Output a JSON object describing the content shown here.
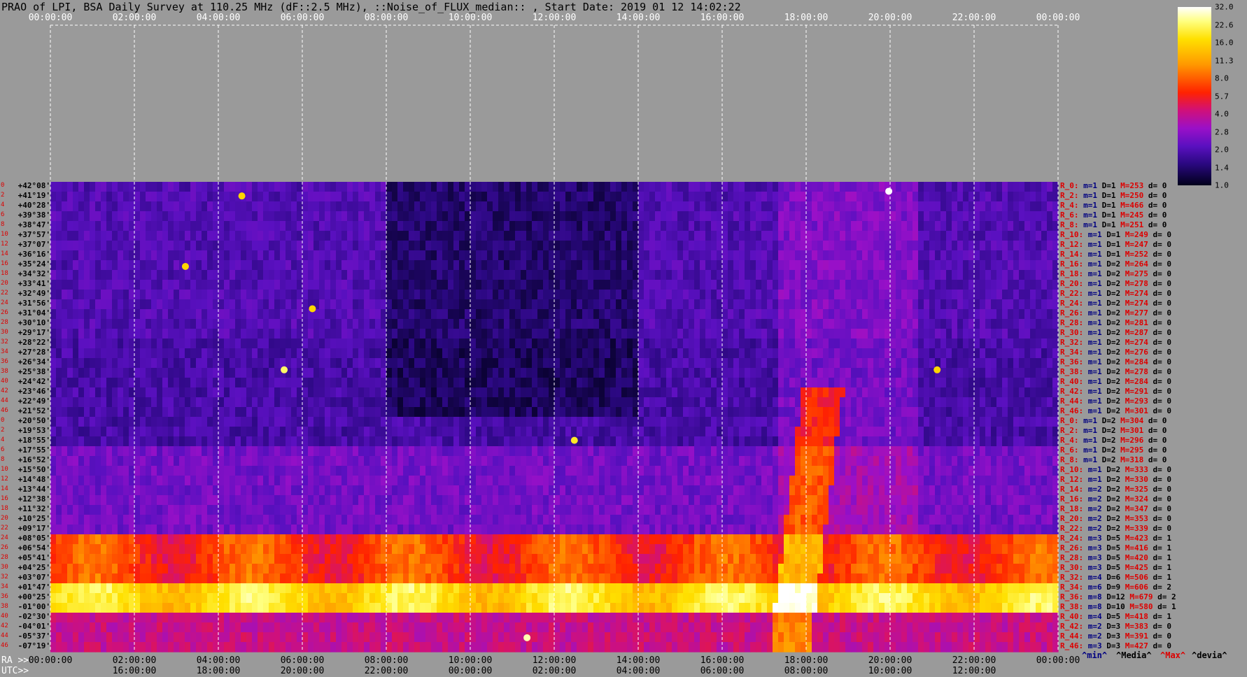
{
  "title": "PRAO of LPI, BSA Daily Survey at 110.25 MHz (dF::2.5 MHz), ::Noise_of_FLUX_median:: , Start Date: 2019 01 12 14:02:22",
  "axis": {
    "ra_prefix": "RA >>",
    "utc_prefix": "UTC>>"
  },
  "chart_data": {
    "type": "heatmap",
    "title": "PRAO of LPI, BSA Daily Survey at 110.25 MHz (dF::2.5 MHz), ::Noise_of_FLUX_median:: , Start Date: 2019 01 12 14:02:22",
    "x_ticks_top": [
      "00:00:00",
      "02:00:00",
      "04:00:00",
      "06:00:00",
      "08:00:00",
      "10:00:00",
      "12:00:00",
      "14:00:00",
      "16:00:00",
      "18:00:00",
      "20:00:00",
      "22:00:00",
      "00:00:00"
    ],
    "x_ticks_ra": [
      "00:00:00",
      "02:00:00",
      "04:00:00",
      "06:00:00",
      "08:00:00",
      "10:00:00",
      "12:00:00",
      "14:00:00",
      "16:00:00",
      "18:00:00",
      "20:00:00",
      "22:00:00",
      "00:00:00"
    ],
    "x_ticks_utc": [
      "16:00:00",
      "18:00:00",
      "20:00:00",
      "22:00:00",
      "00:00:00",
      "02:00:00",
      "04:00:00",
      "06:00:00",
      "08:00:00",
      "10:00:00",
      "12:00:00"
    ],
    "y_ticks_dec": [
      "+42°08'",
      "+41°19'",
      "+40°28'",
      "+39°38'",
      "+38°47'",
      "+37°57'",
      "+37°07'",
      "+36°16'",
      "+35°24'",
      "+34°32'",
      "+33°41'",
      "+32°49'",
      "+31°56'",
      "+31°04'",
      "+30°10'",
      "+29°17'",
      "+28°22'",
      "+27°28'",
      "+26°34'",
      "+25°38'",
      "+24°42'",
      "+23°46'",
      "+22°49'",
      "+21°52'",
      "+20°50'",
      "+19°53'",
      "+18°55'",
      "+17°55'",
      "+16°52'",
      "+15°50'",
      "+14°48'",
      "+13°44'",
      "+12°38'",
      "+11°32'",
      "+10°25'",
      "+09°17'",
      "+08°05'",
      "+06°54'",
      "+05°41'",
      "+04°25'",
      "+03°07'",
      "+01°47'",
      "+00°25'",
      "-01°00'",
      "-02°30'",
      "-04°01'",
      "-05°37'",
      "-07°19'"
    ],
    "colorbar_ticks": [
      "32.0",
      "22.6",
      "16.0",
      "11.3",
      "8.0",
      "5.7",
      "4.0",
      "2.8",
      "2.0",
      "1.4",
      "1.0"
    ],
    "colorbar_scale": "log",
    "legend": [
      "^min^",
      "^Media^",
      "^Max^",
      "^devia^"
    ],
    "row_stats": [
      {
        "r": "R_0:",
        "m": "m=1",
        "D": "D=1",
        "M": "M=253",
        "d": "d= 0"
      },
      {
        "r": "R_2:",
        "m": "m=1",
        "D": "D=1",
        "M": "M=250",
        "d": "d= 0"
      },
      {
        "r": "R_4:",
        "m": "m=1",
        "D": "D=1",
        "M": "M=466",
        "d": "d= 0"
      },
      {
        "r": "R_6:",
        "m": "m=1",
        "D": "D=1",
        "M": "M=245",
        "d": "d= 0"
      },
      {
        "r": "R_8:",
        "m": "m=1",
        "D": "D=1",
        "M": "M=251",
        "d": "d= 0"
      },
      {
        "r": "R_10:",
        "m": "m=1",
        "D": "D=1",
        "M": "M=249",
        "d": "d= 0"
      },
      {
        "r": "R_12:",
        "m": "m=1",
        "D": "D=1",
        "M": "M=247",
        "d": "d= 0"
      },
      {
        "r": "R_14:",
        "m": "m=1",
        "D": "D=1",
        "M": "M=252",
        "d": "d= 0"
      },
      {
        "r": "R_16:",
        "m": "m=1",
        "D": "D=2",
        "M": "M=264",
        "d": "d= 0"
      },
      {
        "r": "R_18:",
        "m": "m=1",
        "D": "D=2",
        "M": "M=275",
        "d": "d= 0"
      },
      {
        "r": "R_20:",
        "m": "m=1",
        "D": "D=2",
        "M": "M=278",
        "d": "d= 0"
      },
      {
        "r": "R_22:",
        "m": "m=1",
        "D": "D=2",
        "M": "M=274",
        "d": "d= 0"
      },
      {
        "r": "R_24:",
        "m": "m=1",
        "D": "D=2",
        "M": "M=274",
        "d": "d= 0"
      },
      {
        "r": "R_26:",
        "m": "m=1",
        "D": "D=2",
        "M": "M=277",
        "d": "d= 0"
      },
      {
        "r": "R_28:",
        "m": "m=1",
        "D": "D=2",
        "M": "M=281",
        "d": "d= 0"
      },
      {
        "r": "R_30:",
        "m": "m=1",
        "D": "D=2",
        "M": "M=287",
        "d": "d= 0"
      },
      {
        "r": "R_32:",
        "m": "m=1",
        "D": "D=2",
        "M": "M=274",
        "d": "d= 0"
      },
      {
        "r": "R_34:",
        "m": "m=1",
        "D": "D=2",
        "M": "M=276",
        "d": "d= 0"
      },
      {
        "r": "R_36:",
        "m": "m=1",
        "D": "D=2",
        "M": "M=284",
        "d": "d= 0"
      },
      {
        "r": "R_38:",
        "m": "m=1",
        "D": "D=2",
        "M": "M=278",
        "d": "d= 0"
      },
      {
        "r": "R_40:",
        "m": "m=1",
        "D": "D=2",
        "M": "M=284",
        "d": "d= 0"
      },
      {
        "r": "R_42:",
        "m": "m=1",
        "D": "D=2",
        "M": "M=291",
        "d": "d= 0"
      },
      {
        "r": "R_44:",
        "m": "m=1",
        "D": "D=2",
        "M": "M=293",
        "d": "d= 0"
      },
      {
        "r": "R_46:",
        "m": "m=1",
        "D": "D=2",
        "M": "M=301",
        "d": "d= 0"
      },
      {
        "r": "R_0:",
        "m": "m=1",
        "D": "D=2",
        "M": "M=304",
        "d": "d= 0"
      },
      {
        "r": "R_2:",
        "m": "m=1",
        "D": "D=2",
        "M": "M=301",
        "d": "d= 0"
      },
      {
        "r": "R_4:",
        "m": "m=1",
        "D": "D=2",
        "M": "M=296",
        "d": "d= 0"
      },
      {
        "r": "R_6:",
        "m": "m=1",
        "D": "D=2",
        "M": "M=295",
        "d": "d= 0"
      },
      {
        "r": "R_8:",
        "m": "m=1",
        "D": "D=2",
        "M": "M=318",
        "d": "d= 0"
      },
      {
        "r": "R_10:",
        "m": "m=1",
        "D": "D=2",
        "M": "M=333",
        "d": "d= 0"
      },
      {
        "r": "R_12:",
        "m": "m=1",
        "D": "D=2",
        "M": "M=330",
        "d": "d= 0"
      },
      {
        "r": "R_14:",
        "m": "m=2",
        "D": "D=2",
        "M": "M=325",
        "d": "d= 0"
      },
      {
        "r": "R_16:",
        "m": "m=2",
        "D": "D=2",
        "M": "M=324",
        "d": "d= 0"
      },
      {
        "r": "R_18:",
        "m": "m=2",
        "D": "D=2",
        "M": "M=347",
        "d": "d= 0"
      },
      {
        "r": "R_20:",
        "m": "m=2",
        "D": "D=2",
        "M": "M=353",
        "d": "d= 0"
      },
      {
        "r": "R_22:",
        "m": "m=2",
        "D": "D=2",
        "M": "M=339",
        "d": "d= 0"
      },
      {
        "r": "R_24:",
        "m": "m=3",
        "D": "D=5",
        "M": "M=423",
        "d": "d= 1"
      },
      {
        "r": "R_26:",
        "m": "m=3",
        "D": "D=5",
        "M": "M=416",
        "d": "d= 1"
      },
      {
        "r": "R_28:",
        "m": "m=3",
        "D": "D=5",
        "M": "M=420",
        "d": "d= 1"
      },
      {
        "r": "R_30:",
        "m": "m=3",
        "D": "D=5",
        "M": "M=425",
        "d": "d= 1"
      },
      {
        "r": "R_32:",
        "m": "m=4",
        "D": "D=6",
        "M": "M=506",
        "d": "d= 1"
      },
      {
        "r": "R_34:",
        "m": "m=6",
        "D": "D=9",
        "M": "M=606",
        "d": "d= 2"
      },
      {
        "r": "R_36:",
        "m": "m=8",
        "D": "D=12",
        "M": "M=679",
        "d": "d= 2"
      },
      {
        "r": "R_38:",
        "m": "m=8",
        "D": "D=10",
        "M": "M=580",
        "d": "d= 1"
      },
      {
        "r": "R_40:",
        "m": "m=4",
        "D": "D=5",
        "M": "M=418",
        "d": "d= 1"
      },
      {
        "r": "R_42:",
        "m": "m=2",
        "D": "D=3",
        "M": "M=383",
        "d": "d= 0"
      },
      {
        "r": "R_44:",
        "m": "m=2",
        "D": "D=3",
        "M": "M=391",
        "d": "d= 0"
      },
      {
        "r": "R_46:",
        "m": "m=3",
        "D": "D=3",
        "M": "M=427",
        "d": "d= 0"
      }
    ],
    "row_numbers": [
      "0",
      "2",
      "4",
      "6",
      "8",
      "10",
      "12",
      "14",
      "16",
      "18",
      "20",
      "22",
      "24",
      "26",
      "28",
      "30",
      "32",
      "34",
      "36",
      "38",
      "40",
      "42",
      "44",
      "46",
      "0",
      "2",
      "4",
      "6",
      "8",
      "10",
      "12",
      "14",
      "16",
      "18",
      "20",
      "22",
      "24",
      "26",
      "28",
      "30",
      "32",
      "34",
      "36",
      "38",
      "40",
      "42",
      "44",
      "46"
    ],
    "colors": {
      "background": "#9a9a9a",
      "grid": "#ffffff",
      "stat_red": "#dd0000",
      "stat_blue": "#000080"
    }
  }
}
